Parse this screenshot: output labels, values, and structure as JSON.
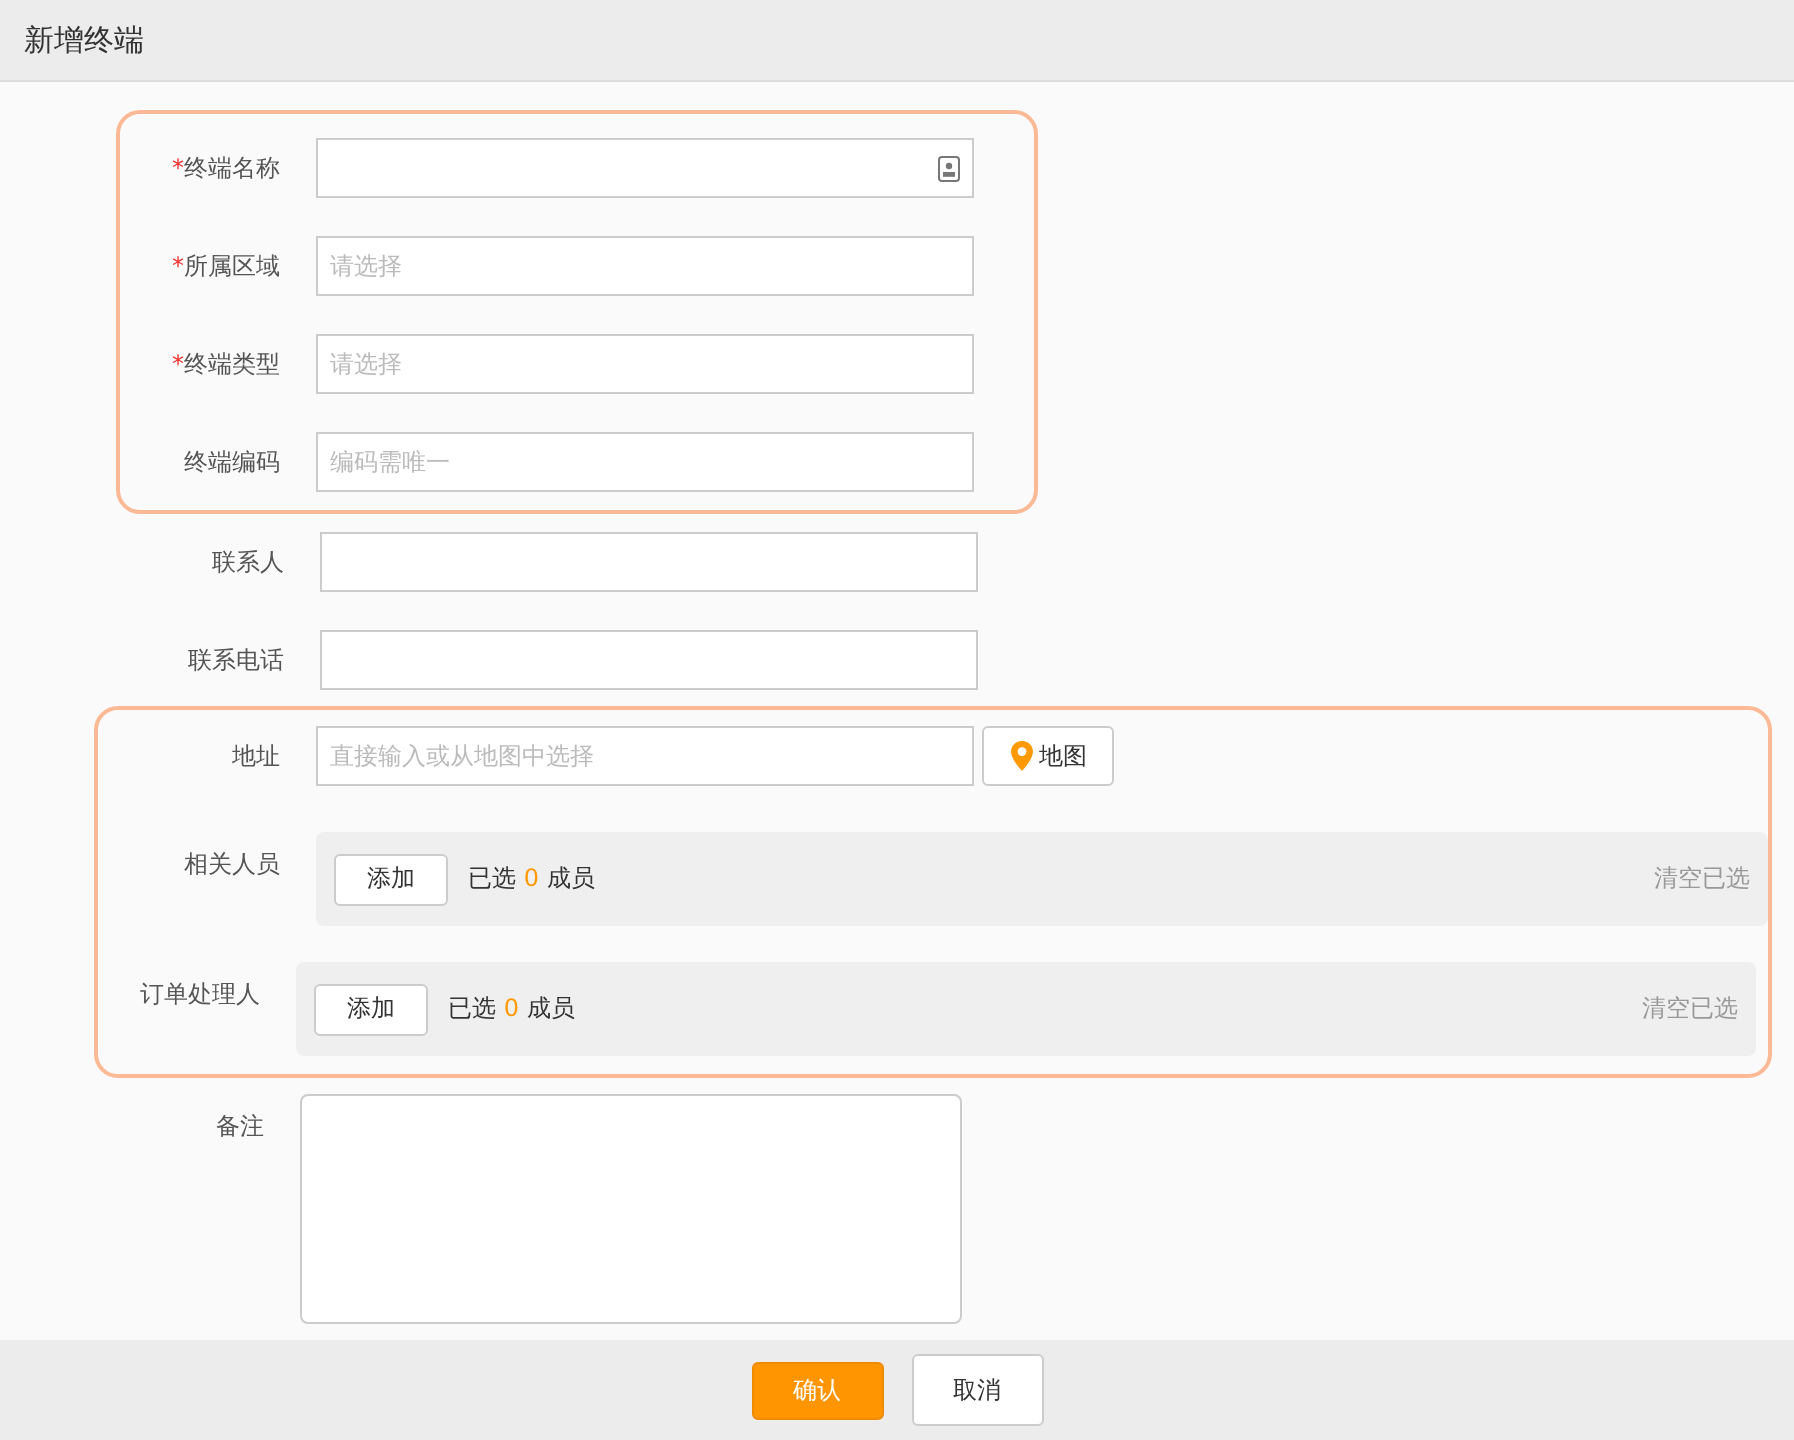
{
  "window": {
    "title": "新增终端"
  },
  "sections": [
    {
      "highlighted": true,
      "fields": [
        {
          "kind": "input",
          "label": "终端名称",
          "required_mark": "*",
          "card_icon": true
        },
        {
          "kind": "input",
          "label": "所属区域",
          "required_mark": "*",
          "placeholder": "请选择"
        },
        {
          "kind": "input",
          "label": "终端类型",
          "required_mark": "*",
          "placeholder": "请选择"
        },
        {
          "kind": "input",
          "label": "终端编码",
          "placeholder": "编码需唯一"
        }
      ]
    },
    {
      "fields": [
        {
          "kind": "input",
          "label": "联系人"
        },
        {
          "kind": "input",
          "label": "联系电话"
        }
      ]
    },
    {
      "highlighted": true,
      "fields": [
        {
          "kind": "address",
          "label": "地址",
          "placeholder": "直接输入或从地图中选择",
          "map_button": "地图"
        },
        {
          "kind": "members",
          "label": "相关人员",
          "add_button": "添加",
          "selected_prefix": "已选",
          "count": "0",
          "selected_suffix": "成员",
          "clear": "清空已选"
        },
        {
          "kind": "members",
          "label": "订单处理人",
          "add_button": "添加",
          "selected_prefix": "已选",
          "count": "0",
          "selected_suffix": "成员",
          "clear": "清空已选"
        }
      ]
    },
    {
      "fields": [
        {
          "kind": "textarea",
          "label": "备注"
        }
      ]
    }
  ],
  "buttons": [
    {
      "label": "确认",
      "primary": true
    },
    {
      "label": "取消",
      "primary": false
    }
  ]
}
